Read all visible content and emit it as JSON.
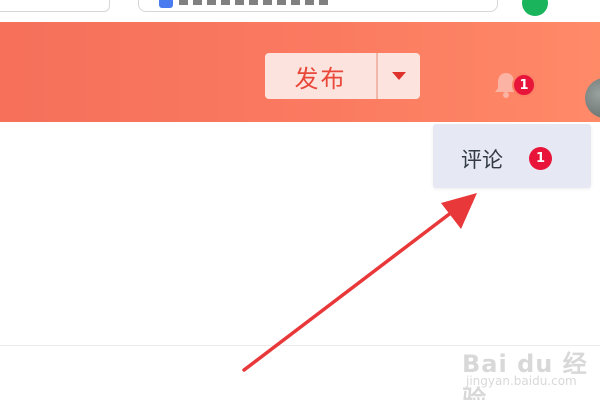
{
  "header": {
    "publish_label": "发布",
    "notification_count": "1"
  },
  "notifications_menu": {
    "items": [
      {
        "label": "评论",
        "count": "1"
      }
    ]
  },
  "watermark": {
    "brand": "Bai du 经验",
    "site": "jingyan.baidu.com"
  },
  "colors": {
    "header_start": "#f6705a",
    "header_end": "#ff8a68",
    "badge": "#e8143a",
    "publish_text": "#e8473a",
    "menu_bg": "#e6e9f3",
    "arrow": "#e8383a"
  },
  "icons": [
    "bell-icon",
    "chevron-down-icon",
    "avatar"
  ]
}
